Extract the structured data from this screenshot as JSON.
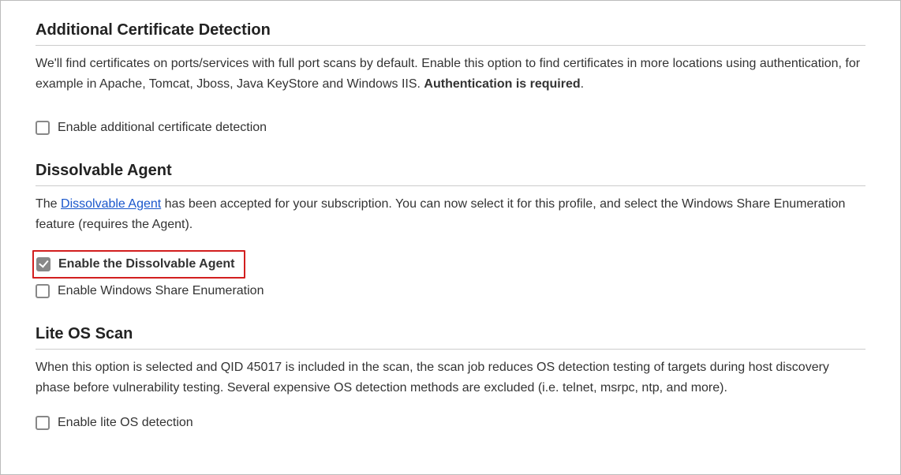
{
  "sections": {
    "certDetection": {
      "heading": "Additional Certificate Detection",
      "descPart1": "We'll find certificates on ports/services with full port scans by default. Enable this option to find certificates in more locations using authentication, for example in Apache, Tomcat, Jboss, Java KeyStore and Windows IIS. ",
      "descBold": "Authentication is required",
      "descEnd": ".",
      "options": {
        "enableAdditional": {
          "label": "Enable additional certificate detection",
          "checked": false
        }
      }
    },
    "dissolvableAgent": {
      "heading": "Dissolvable Agent",
      "descPart1": "The ",
      "descLink": "Dissolvable Agent",
      "descPart2": " has been accepted for your subscription. You can now select it for this profile, and select the Windows Share Enumeration feature (requires the Agent).",
      "options": {
        "enableAgent": {
          "label": "Enable the Dissolvable Agent",
          "checked": true,
          "highlighted": true
        },
        "enableWinShare": {
          "label": "Enable Windows Share Enumeration",
          "checked": false
        }
      }
    },
    "liteOSScan": {
      "heading": "Lite OS Scan",
      "desc": "When this option is selected and QID 45017 is included in the scan, the scan job reduces OS detection testing of targets during host discovery phase before vulnerability testing. Several expensive OS detection methods are excluded (i.e. telnet, msrpc, ntp, and more).",
      "options": {
        "enableLite": {
          "label": "Enable lite OS detection",
          "checked": false
        }
      }
    }
  }
}
